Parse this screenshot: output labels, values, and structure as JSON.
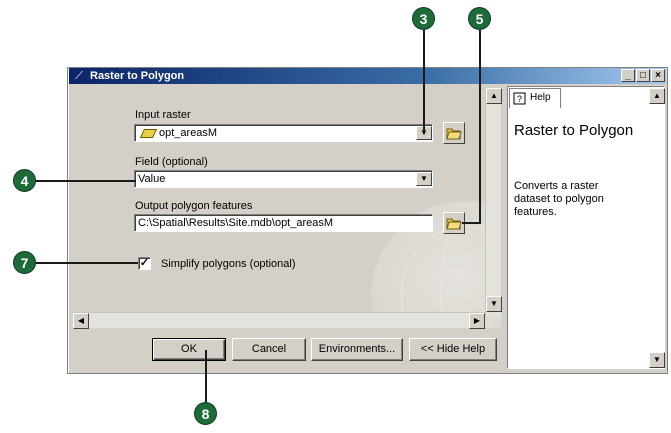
{
  "window": {
    "title": "Raster to Polygon",
    "minimize_glyph": "_",
    "maximize_glyph": "□",
    "close_glyph": "×"
  },
  "form": {
    "input_raster_label": "Input raster",
    "input_raster_value": "opt_areasM",
    "field_label": "Field (optional)",
    "field_value": "Value",
    "output_label": "Output polygon features",
    "output_value": "C:\\Spatial\\Results\\Site.mdb\\opt_areasM",
    "simplify_label": "Simplify polygons (optional)",
    "simplify_checked": true
  },
  "buttons": {
    "ok": "OK",
    "cancel": "Cancel",
    "environments": "Environments...",
    "hide_help": "<< Hide Help"
  },
  "help": {
    "tab_label": "Help",
    "title": "Raster to Polygon",
    "description": "Converts a raster dataset to polygon features."
  },
  "callouts": {
    "c3": "3",
    "c4": "4",
    "c5": "5",
    "c7": "7",
    "c8": "8"
  },
  "colors": {
    "callout": "#1e6b3a",
    "titlebar_start": "#0a246a",
    "dialog_bg": "#d4d0c8"
  }
}
